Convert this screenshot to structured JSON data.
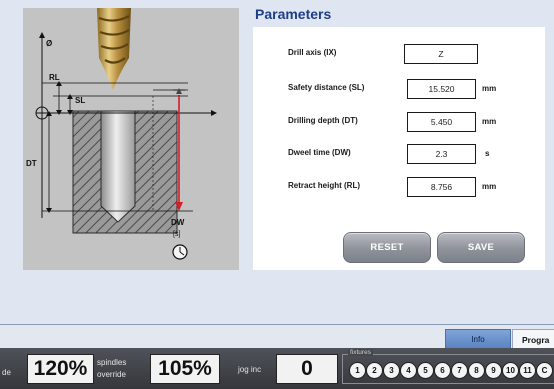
{
  "parameters": {
    "title": "Parameters",
    "fields": [
      {
        "label": "Drill axis (IX)",
        "value": "Z",
        "unit": ""
      },
      {
        "label": "Safety distance (SL)",
        "value": "15.520",
        "unit": "mm"
      },
      {
        "label": "Drilling depth (DT)",
        "value": "5.450",
        "unit": "mm"
      },
      {
        "label": "Dweel time (DW)",
        "value": "2.3",
        "unit": "s"
      },
      {
        "label": "Retract height (RL)",
        "value": "8.756",
        "unit": "mm"
      }
    ],
    "reset_label": "RESET",
    "save_label": "SAVE"
  },
  "diagram": {
    "diameter_label": "Ø",
    "rl_label": "RL",
    "sl_label": "SL",
    "dt_label": "DT",
    "dw_label": "DW",
    "dw_unit": "[s]"
  },
  "tabs": {
    "info": "Info",
    "program": "Progra"
  },
  "status_bar": {
    "left_fragment": "de",
    "spindles_value": "120%",
    "spindles_label_1": "spindles",
    "spindles_label_2": "override",
    "override_value": "105%",
    "jog_label": "jog inc",
    "jog_value": "0",
    "fixtures_label": "fixtures",
    "fixtures": [
      "1",
      "2",
      "3",
      "4",
      "5",
      "6",
      "7",
      "8",
      "9",
      "10",
      "11",
      "C"
    ]
  },
  "colors": {
    "title_blue": "#1f3e88",
    "info_tab": "#6d93cc",
    "arrow_red": "#d0202a"
  }
}
